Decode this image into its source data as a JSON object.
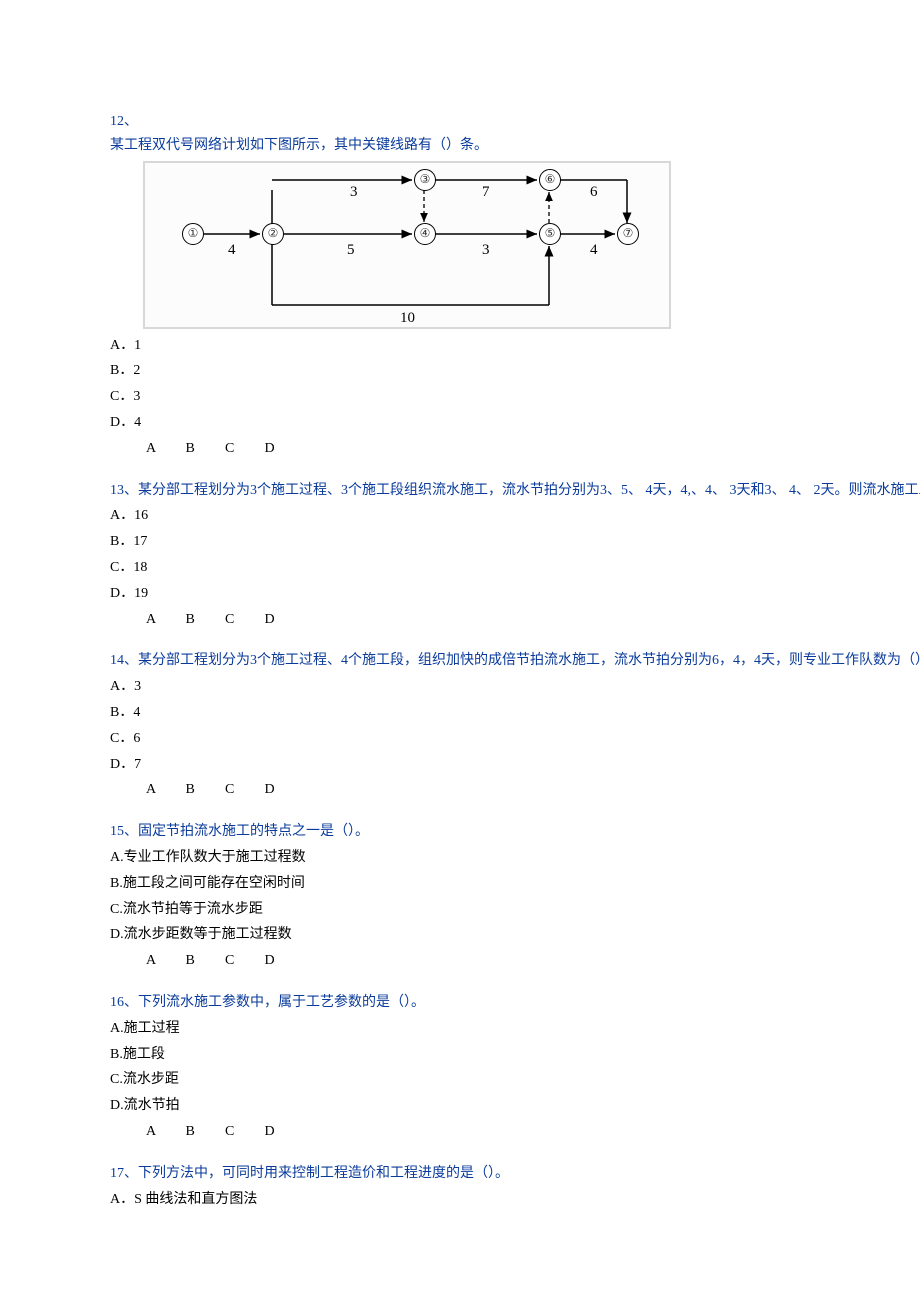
{
  "q12": {
    "num": "12、",
    "text": "某工程双代号网络计划如下图所示，其中关键线路有（）条。",
    "diagram": {
      "nodes": [
        "①",
        "②",
        "③",
        "④",
        "⑤",
        "⑥",
        "⑦"
      ],
      "edge_labels": [
        "3",
        "7",
        "6",
        "4",
        "5",
        "3",
        "4",
        "10"
      ]
    },
    "opts": [
      "A．1",
      "B．2",
      "C．3",
      "D．4"
    ],
    "answers": [
      "A",
      "B",
      "C",
      "D"
    ]
  },
  "q13": {
    "num": "13、",
    "text": "某分部工程划分为3个施工过程、3个施工段组织流水施工，流水节拍分别为3、5、 4天，4,、4、 3天和3、 4、 2天。则流水施工工期为（）天。",
    "opts": [
      "A．16",
      "B．17",
      "C．18",
      "D．19"
    ],
    "answers": [
      "A",
      "B",
      "C",
      "D"
    ]
  },
  "q14": {
    "num": "14、",
    "text": "某分部工程划分为3个施工过程、4个施工段，组织加快的成倍节拍流水施工，流水节拍分别为6，4，4天，则专业工作队数为（）个。",
    "opts": [
      "A．3",
      "B．4",
      "C．6",
      "D．7"
    ],
    "answers": [
      "A",
      "B",
      "C",
      "D"
    ]
  },
  "q15": {
    "num": "15、",
    "text": "固定节拍流水施工的特点之一是（）。",
    "opts": [
      "A.专业工作队数大于施工过程数",
      "B.施工段之间可能存在空闲时间",
      "C.流水节拍等于流水步距",
      "D.流水步距数等于施工过程数"
    ],
    "answers": [
      "A",
      "B",
      "C",
      "D"
    ]
  },
  "q16": {
    "num": "16、",
    "text": "下列流水施工参数中，属于工艺参数的是（）。",
    "opts": [
      "A.施工过程",
      "B.施工段",
      "C.流水步距",
      "D.流水节拍"
    ],
    "answers": [
      "A",
      "B",
      "C",
      "D"
    ]
  },
  "q17": {
    "num": "17、",
    "text": "下列方法中，可同时用来控制工程造价和工程进度的是（）。",
    "opts": [
      "A．S 曲线法和直方图法"
    ]
  }
}
